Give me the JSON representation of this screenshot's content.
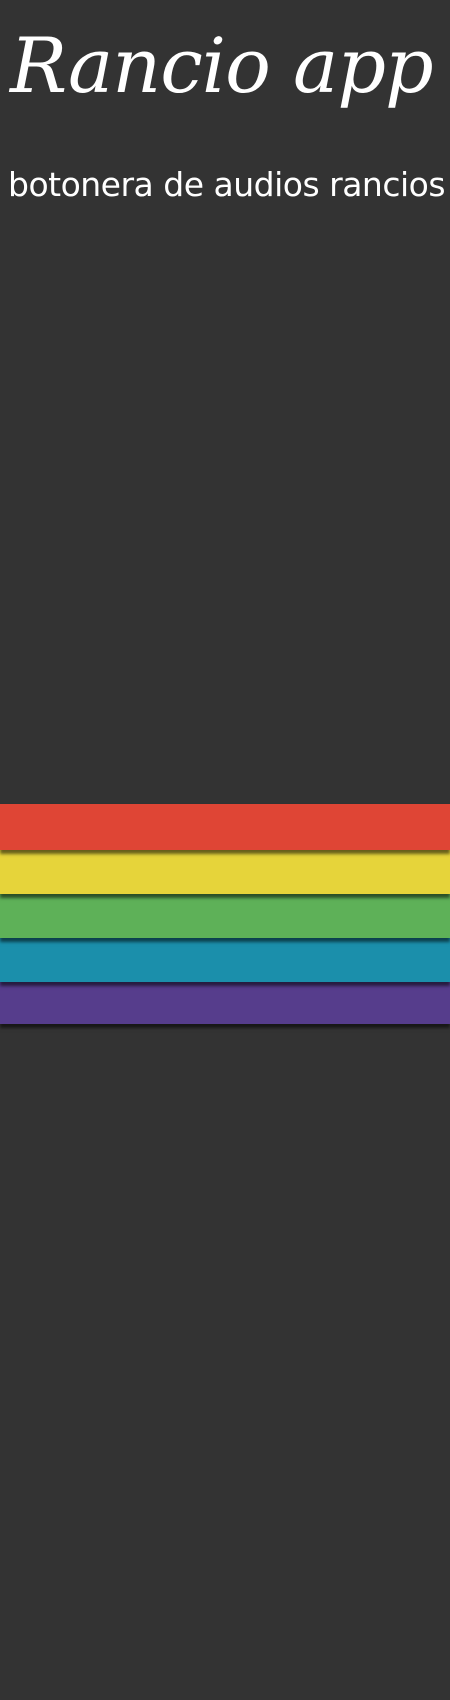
{
  "header": {
    "title": "Rancio app",
    "subtitle": "botonera de audios rancios"
  },
  "theme": {
    "background": "#333333",
    "text_color": "#ffffff"
  },
  "stripes": [
    {
      "color": "#df4535"
    },
    {
      "color": "#e6d43a"
    },
    {
      "color": "#5eb158"
    },
    {
      "color": "#1b8fab"
    },
    {
      "color": "#563d8c"
    }
  ]
}
